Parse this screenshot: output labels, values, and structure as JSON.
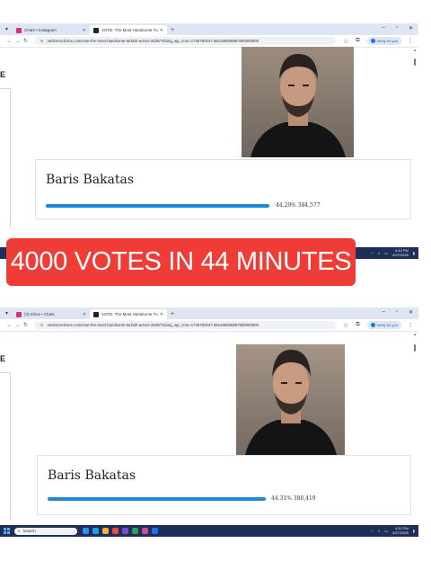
{
  "screenshots": [
    {
      "tabs": [
        {
          "title": "Chats • Instagram",
          "icon": "instagram-icon",
          "color": "#d6336c"
        },
        {
          "title": "VOTE: The Most Handsome Tu...",
          "icon": "nc-site-icon",
          "color": "#222222"
        }
      ],
      "url": "netizenschoice.com/vote-the-most-handsome-turkish-actors-2025/?doing_wp_cron=1745750247.552185055957500000000",
      "profile_label": "Verify it's you",
      "sidebar_letter": "E",
      "candidate": {
        "name": "Baris Bakatas",
        "percent_text": "44.29% 384,577",
        "percent_value": 44.29
      },
      "clock": {
        "time": "4:43 PM",
        "date": "4/27/2025"
      }
    },
    {
      "tabs": [
        {
          "title": "(3) Inbox • Chats",
          "icon": "instagram-icon",
          "color": "#d6336c"
        },
        {
          "title": "VOTE: The Most Handsome Tu...",
          "icon": "nc-site-icon",
          "color": "#222222"
        }
      ],
      "url": "netizenschoice.com/vote-the-most-handsome-turkish-actors-2025/?doing_wp_cron=1745750247.552185055957500000000",
      "profile_label": "Verify it's you",
      "sidebar_letter": "E",
      "candidate": {
        "name": "Baris Bakatas",
        "percent_text": "44.31% 388,419",
        "percent_value": 44.31
      },
      "search_placeholder": "Search",
      "clock": {
        "time": "4:52 PM",
        "date": "4/27/2025"
      }
    }
  ],
  "banner": {
    "text": "4000 VOTES IN 44 MINUTES",
    "color": "#ef3c37"
  },
  "accent": "#1f87d6"
}
